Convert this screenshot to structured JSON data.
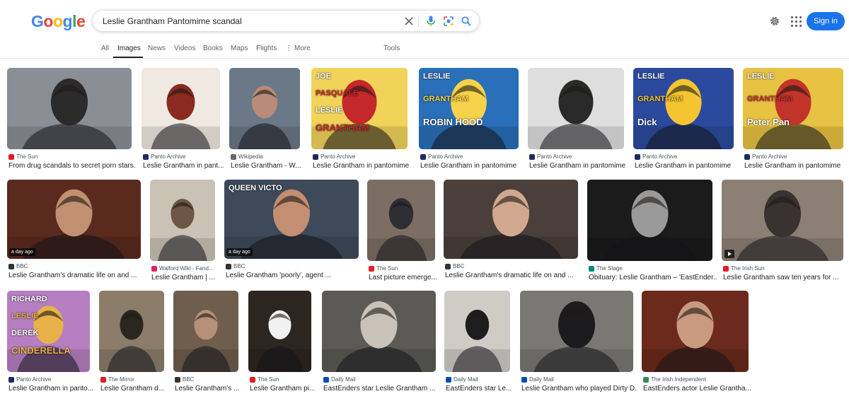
{
  "logo": {
    "letters": [
      "G",
      "o",
      "o",
      "g",
      "l",
      "e"
    ],
    "colors": [
      "#4285f4",
      "#ea4335",
      "#fbbc05",
      "#4285f4",
      "#34a853",
      "#ea4335"
    ]
  },
  "search": {
    "value": "Leslie Grantham Pantomime scandal",
    "clear_icon": "close-icon",
    "voice_icon": "mic-icon",
    "lens_icon": "lens-icon",
    "search_icon": "search-icon"
  },
  "header": {
    "sign_in": "Sign in",
    "settings_icon": "gear-icon",
    "apps_icon": "apps-grid-icon",
    "accent": "#1a73e8"
  },
  "tabs": {
    "all": "All",
    "images": "Images",
    "news": "News",
    "videos": "Videos",
    "books": "Books",
    "maps": "Maps",
    "flights": "Flights",
    "more": "More",
    "tools": "Tools"
  },
  "results": [
    {
      "source": "The Sun",
      "title": "From drug scandals to secret porn stars...",
      "fav": "#e31b23",
      "thumb": {
        "bg": "#8a8f96",
        "fg": "#2b2b2b"
      }
    },
    {
      "source": "Panto Archive",
      "title": "Leslie Grantham in pant...",
      "fav": "#1d2c5e",
      "thumb": {
        "bg": "#efe9e1",
        "fg": "#8b2a1f"
      }
    },
    {
      "source": "Wikipedia",
      "title": "Leslie Grantham - W...",
      "fav": "#666666",
      "thumb": {
        "bg": "#6b7887",
        "fg": "#b98c78"
      }
    },
    {
      "source": "Panto Archive",
      "title": "Leslie Grantham in pantomime",
      "fav": "#1d2c5e",
      "thumb": {
        "bg": "#f1d35a",
        "fg": "#c4282b"
      },
      "poster": [
        "JOE",
        "PASQUALE",
        "LESLIE",
        "GRANTHAM"
      ]
    },
    {
      "source": "Panto Archive",
      "title": "Leslie Grantham in pantomime",
      "fav": "#1d2c5e",
      "thumb": {
        "bg": "#2a6fb9",
        "fg": "#f6d24a"
      },
      "poster": [
        "LESLIE",
        "GRANTHAM",
        "ROBIN HOOD"
      ]
    },
    {
      "source": "Panto Archive",
      "title": "Leslie Grantham in pantomime",
      "fav": "#1d2c5e",
      "thumb": {
        "bg": "#dedede",
        "fg": "#2a2a2a"
      }
    },
    {
      "source": "Panto Archive",
      "title": "Leslie Grantham in pantomime",
      "fav": "#1d2c5e",
      "thumb": {
        "bg": "#2b4a9e",
        "fg": "#f4c531"
      },
      "poster": [
        "LESLIE",
        "GRANTHAM",
        "Dick"
      ]
    },
    {
      "source": "Panto Archive",
      "title": "Leslie Grantham in pantomime",
      "fav": "#1d2c5e",
      "thumb": {
        "bg": "#e8c243",
        "fg": "#c2342a"
      },
      "poster": [
        "LESLIE",
        "GRANTHAM",
        "Peter Pan"
      ]
    },
    {
      "source": "BBC",
      "title": "Leslie Grantham's dramatic life on and ...",
      "fav": "#333333",
      "thumb": {
        "bg": "#5a2a1e",
        "fg": "#c09070"
      },
      "badge": "a day ago"
    },
    {
      "source": "Walford Wiki - Fand...",
      "title": "Leslie Grantham | ...",
      "fav": "#e0245e",
      "thumb": {
        "bg": "#c9c2b5",
        "fg": "#6d5644"
      }
    },
    {
      "source": "BBC",
      "title": "Leslie Grantham 'poorly', agent ...",
      "fav": "#333333",
      "thumb": {
        "bg": "#3d4a5a",
        "fg": "#c38e72"
      },
      "badge": "a day ago",
      "poster": [
        "QUEEN VICTO"
      ]
    },
    {
      "source": "The Sun",
      "title": "Last picture emerge...",
      "fav": "#e31b23",
      "thumb": {
        "bg": "#7d6e63",
        "fg": "#2e2f35"
      }
    },
    {
      "source": "BBC",
      "title": "Leslie Grantham's dramatic life on and ...",
      "fav": "#333333",
      "thumb": {
        "bg": "#4a3f3a",
        "fg": "#d0a88f"
      }
    },
    {
      "source": "The Stage",
      "title": "Obituary: Leslie Grantham – 'EastEnder...",
      "fav": "#00897b",
      "thumb": {
        "bg": "#1b1b1b",
        "fg": "#9a9a9a"
      }
    },
    {
      "source": "The Irish Sun",
      "title": "Leslie Grantham saw ten years for ...",
      "fav": "#e31b23",
      "thumb": {
        "bg": "#8c8074",
        "fg": "#3a3230"
      },
      "video": true
    },
    {
      "source": "Panto Archive",
      "title": "Leslie Grantham in panto...",
      "fav": "#1d2c5e",
      "thumb": {
        "bg": "#b57fc2",
        "fg": "#e8b24a"
      },
      "poster": [
        "RICHARD",
        "LESLIE",
        "DEREK",
        "CINDERELLA"
      ]
    },
    {
      "source": "The Mirror",
      "title": "Leslie Grantham d...",
      "fav": "#e31b23",
      "thumb": {
        "bg": "#8b7d6a",
        "fg": "#2a2620"
      }
    },
    {
      "source": "BBC",
      "title": "Leslie Grantham's ...",
      "fav": "#333333",
      "thumb": {
        "bg": "#6f5e4e",
        "fg": "#b79079"
      }
    },
    {
      "source": "The Sun",
      "title": "Leslie Grantham pi...",
      "fav": "#e31b23",
      "thumb": {
        "bg": "#2d2520",
        "fg": "#f1f1f1"
      }
    },
    {
      "source": "Daily Mail",
      "title": "EastEnders star Leslie Grantham ...",
      "fav": "#004db3",
      "thumb": {
        "bg": "#5b5a55",
        "fg": "#c8c2b8"
      }
    },
    {
      "source": "Daily Mail",
      "title": "EastEnders star Le...",
      "fav": "#004db3",
      "thumb": {
        "bg": "#cfcbc5",
        "fg": "#1e1e1e"
      }
    },
    {
      "source": "Daily Mail",
      "title": "Leslie Grantham who played Dirty D...",
      "fav": "#004db3",
      "thumb": {
        "bg": "#7a7873",
        "fg": "#1c1c1e"
      }
    },
    {
      "source": "The Irish Independent",
      "title": "EastEnders actor Leslie Grantha...",
      "fav": "#2e8b57",
      "thumb": {
        "bg": "#6c2a1c",
        "fg": "#c99a80"
      }
    }
  ]
}
